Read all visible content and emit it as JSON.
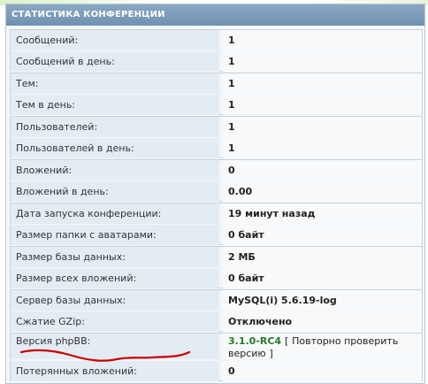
{
  "header": {
    "title": "СТАТИСТИКА КОНФЕРЕНЦИИ"
  },
  "groups": [
    {
      "rows": [
        {
          "label": "Сообщений:",
          "value": "1"
        },
        {
          "label": "Сообщений в день:",
          "value": "1"
        }
      ]
    },
    {
      "rows": [
        {
          "label": "Тем:",
          "value": "1"
        },
        {
          "label": "Тем в день:",
          "value": "1"
        }
      ]
    },
    {
      "rows": [
        {
          "label": "Пользователей:",
          "value": "1"
        },
        {
          "label": "Пользователей в день:",
          "value": "1"
        }
      ]
    },
    {
      "rows": [
        {
          "label": "Вложений:",
          "value": "0"
        },
        {
          "label": "Вложений в день:",
          "value": "0.00"
        }
      ]
    },
    {
      "rows": [
        {
          "label": "Дата запуска конференции:",
          "value": "19 минут назад"
        },
        {
          "label": "Размер папки с аватарами:",
          "value": "0 байт"
        }
      ]
    },
    {
      "rows": [
        {
          "label": "Размер базы данных:",
          "value": "2 МБ"
        },
        {
          "label": "Размер всех вложений:",
          "value": "0 байт"
        }
      ]
    },
    {
      "rows": [
        {
          "label": "Сервер базы данных:",
          "value": "MySQL(i) 5.6.19-log"
        },
        {
          "label": "Сжатие GZip:",
          "value": "Отключено"
        }
      ]
    },
    {
      "rows": [
        {
          "label": "Версия phpBB:",
          "value": "3.1.0-RC4"
        },
        {
          "label": "Потерянных вложений:",
          "value": "0"
        }
      ]
    }
  ],
  "version_check": {
    "open_bracket": "[",
    "link_line1": "Повторно проверить",
    "link_line2": "версию",
    "close_bracket": "]"
  },
  "colors": {
    "header_bg": "#7a9ab8",
    "version_green": "#2a7a2a",
    "annotation_red": "#cc0000"
  }
}
